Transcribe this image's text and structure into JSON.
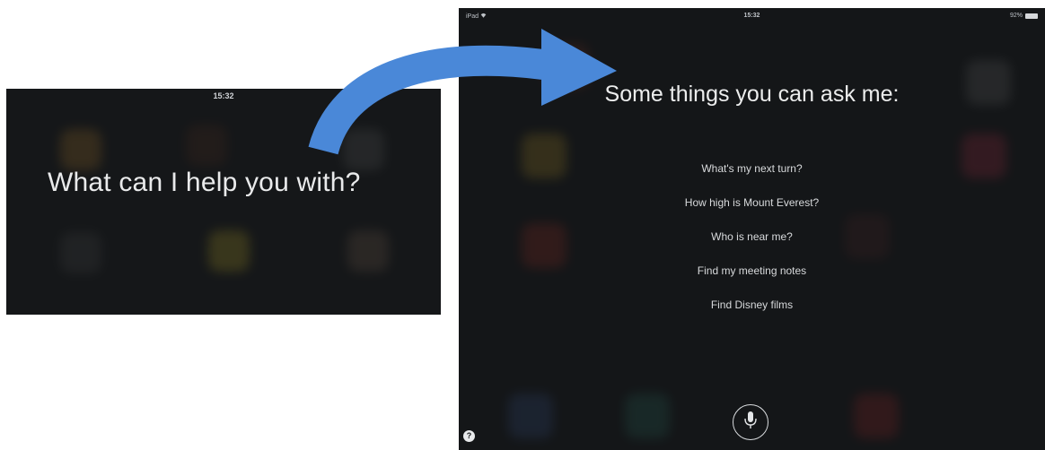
{
  "left_screen": {
    "time": "15:32",
    "prompt": "What can I help you with?"
  },
  "right_screen": {
    "status": {
      "carrier": "iPad",
      "time": "15:32",
      "battery": "92%"
    },
    "headline": "Some things you can ask me:",
    "suggestions": [
      "What's my next turn?",
      "How high is Mount Everest?",
      "Who is near me?",
      "Find my meeting notes",
      "Find Disney films"
    ],
    "help_label": "?"
  },
  "icons": {
    "arrow": "curved-arrow-icon",
    "microphone": "microphone-icon",
    "help": "help-icon",
    "wifi": "wifi-icon",
    "battery": "battery-icon"
  },
  "colors": {
    "arrow": "#4a88d8",
    "screen_background": "#141618",
    "text": "#eceded"
  }
}
